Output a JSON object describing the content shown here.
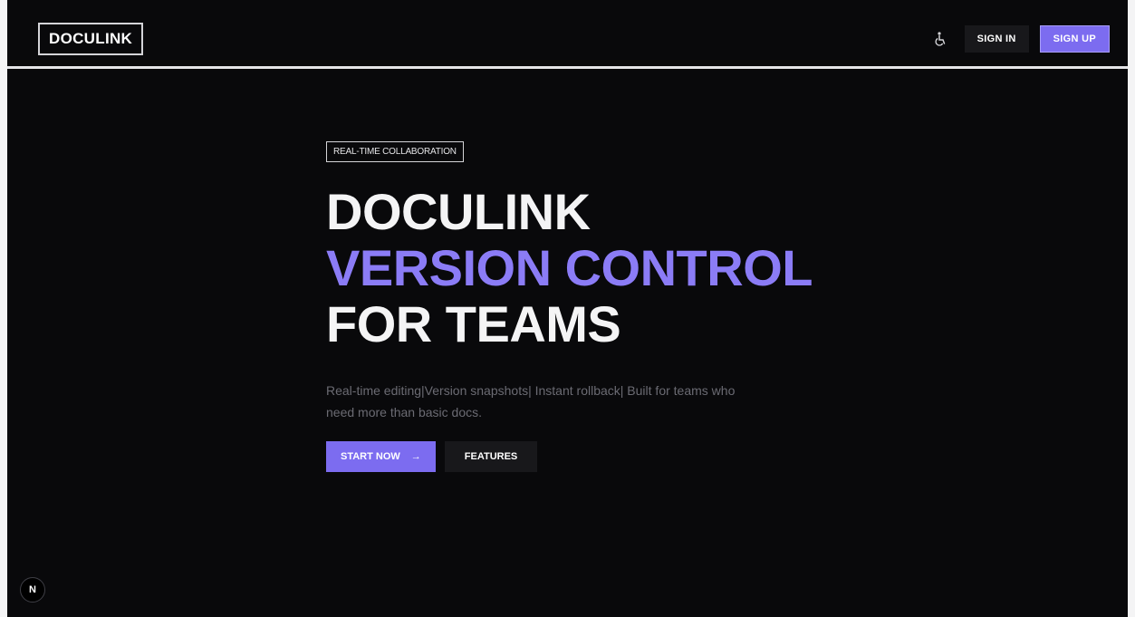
{
  "header": {
    "logo": "DOCULINK",
    "theme_icon": "accessibility-icon",
    "signin_label": "SIGN IN",
    "signup_label": "SIGN UP"
  },
  "hero": {
    "badge": "REAL-TIME COLLABORATION",
    "headline_line1": "DOCULINK",
    "headline_line2": "VERSION CONTROL",
    "headline_line3": "FOR TEAMS",
    "subtext": "Real-time editing|Version snapshots| Instant rollback| Built for teams who need more than basic docs.",
    "start_label": "START NOW",
    "start_arrow": "→",
    "features_label": "FEATURES"
  },
  "dev_badge": {
    "label": "N"
  },
  "colors": {
    "accent": "#7c6cf0",
    "background": "#09090b",
    "headline_accent": "#8b7cf6"
  }
}
